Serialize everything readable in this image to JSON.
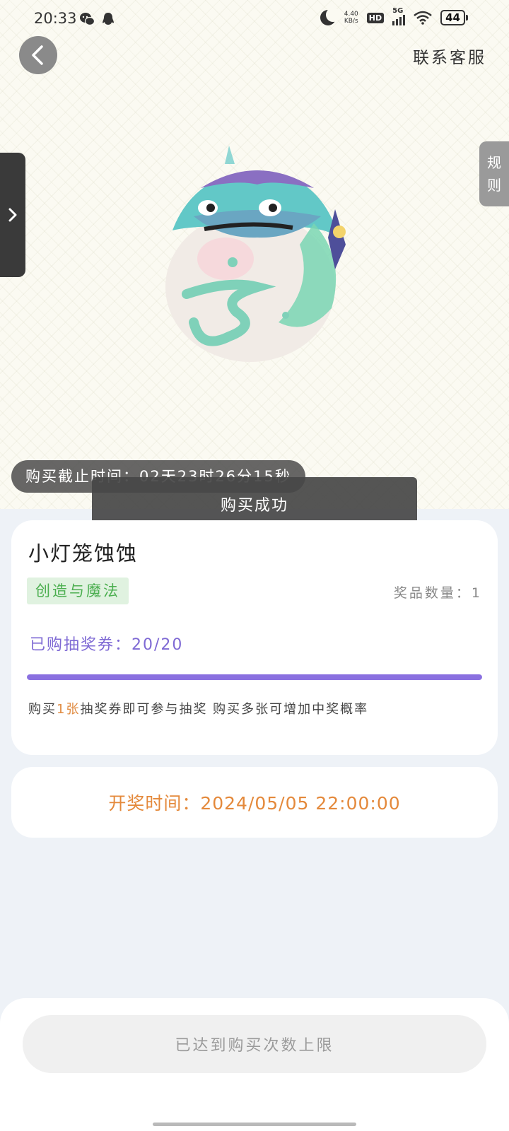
{
  "status_bar": {
    "time": "20:33",
    "net_speed_top": "4.40",
    "net_speed_bottom": "KB/s",
    "hd": "HD",
    "network": "5G",
    "battery": "44"
  },
  "header": {
    "contact_label": "联系客服"
  },
  "rules_tab": [
    "规",
    "则"
  ],
  "deadline": {
    "text": "购买截止时间：02天23时26分15秒"
  },
  "toast": {
    "text": "购买成功"
  },
  "prize": {
    "name": "小灯笼蚀蚀",
    "tag": "创造与魔法",
    "quantity_text": "奖品数量：1",
    "purchased_text": "已购抽奖券：20/20",
    "progress": 1.0,
    "note_prefix": "购买",
    "note_highlight": "1张",
    "note_suffix": "抽奖券即可参与抽奖 购买多张可增加中奖概率"
  },
  "draw": {
    "time_text": "开奖时间：2024/05/05 22:00:00"
  },
  "bottom": {
    "button_label": "已达到购买次数上限"
  },
  "colors": {
    "accent_purple": "#8a70e0",
    "draw_orange": "#e4893b",
    "tag_green": "#4caf50"
  }
}
